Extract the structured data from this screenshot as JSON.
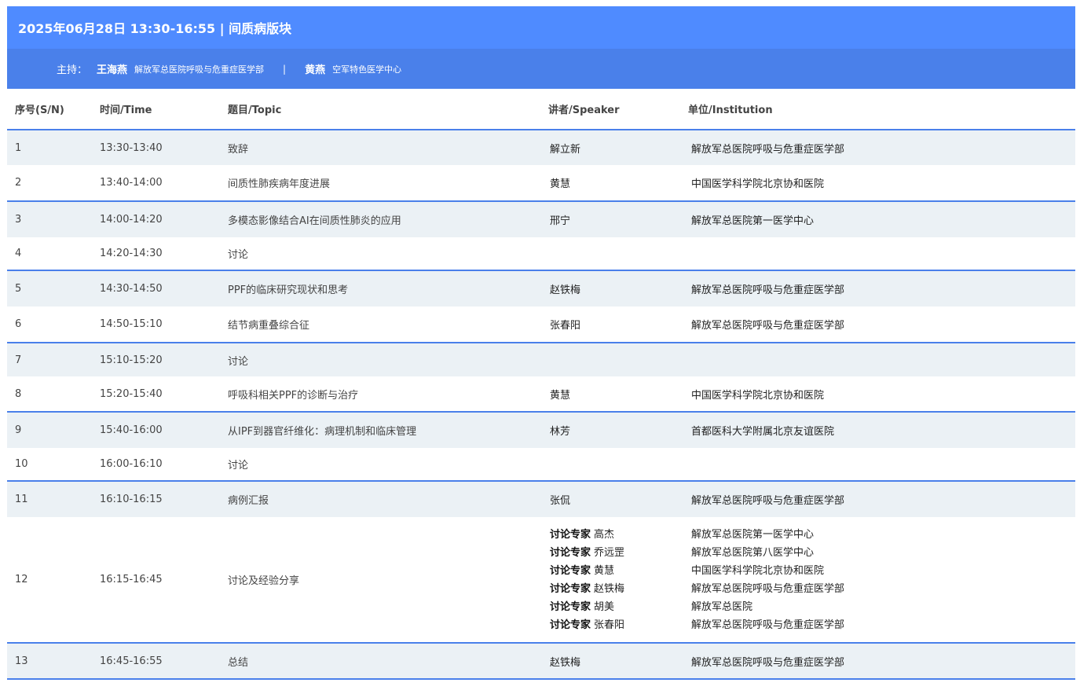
{
  "session": {
    "title": "2025年06月28日 13:30-16:55 | 间质病版块",
    "host_label": "主持：",
    "hosts": [
      {
        "name": "王海燕",
        "institution": "解放军总医院呼吸与危重症医学部"
      },
      {
        "name": "黄燕",
        "institution": "空军特色医学中心"
      }
    ],
    "host_separator": "|"
  },
  "table": {
    "headers": {
      "sn": "序号(S/N)",
      "time": "时间/Time",
      "topic": "题目/Topic",
      "speaker": "讲者/Speaker",
      "institution": "单位/Institution"
    },
    "rows": [
      {
        "sn": "1",
        "time": "13:30-13:40",
        "topic": "致辞",
        "speaker": "解立新",
        "institution": "解放军总医院呼吸与危重症医学部"
      },
      {
        "sn": "2",
        "time": "13:40-14:00",
        "topic": "间质性肺疾病年度进展",
        "speaker": "黄慧",
        "institution": "中国医学科学院北京协和医院"
      },
      {
        "sn": "3",
        "time": "14:00-14:20",
        "topic": "多模态影像结合AI在间质性肺炎的应用",
        "speaker": "邢宁",
        "institution": "解放军总医院第一医学中心"
      },
      {
        "sn": "4",
        "time": "14:20-14:30",
        "topic": "讨论",
        "speaker": "",
        "institution": ""
      },
      {
        "sn": "5",
        "time": "14:30-14:50",
        "topic": "PPF的临床研究现状和思考",
        "speaker": "赵铁梅",
        "institution": "解放军总医院呼吸与危重症医学部"
      },
      {
        "sn": "6",
        "time": "14:50-15:10",
        "topic": "结节病重叠综合征",
        "speaker": "张春阳",
        "institution": "解放军总医院呼吸与危重症医学部"
      },
      {
        "sn": "7",
        "time": "15:10-15:20",
        "topic": "讨论",
        "speaker": "",
        "institution": ""
      },
      {
        "sn": "8",
        "time": "15:20-15:40",
        "topic": "呼吸科相关PPF的诊断与治疗",
        "speaker": "黄慧",
        "institution": "中国医学科学院北京协和医院"
      },
      {
        "sn": "9",
        "time": "15:40-16:00",
        "topic": "从IPF到器官纤维化：病理机制和临床管理",
        "speaker": "林芳",
        "institution": "首都医科大学附属北京友谊医院"
      },
      {
        "sn": "10",
        "time": "16:00-16:10",
        "topic": "讨论",
        "speaker": "",
        "institution": ""
      },
      {
        "sn": "11",
        "time": "16:10-16:15",
        "topic": "病例汇报",
        "speaker": "张侃",
        "institution": "解放军总医院呼吸与危重症医学部"
      },
      {
        "sn": "12",
        "time": "16:15-16:45",
        "topic": "讨论及经验分享",
        "speaker": "",
        "institution": ""
      },
      {
        "sn": "13",
        "time": "16:45-16:55",
        "topic": "总结",
        "speaker": "赵铁梅",
        "institution": "解放军总医院呼吸与危重症医学部"
      }
    ],
    "panel": {
      "role_label": "讨论专家",
      "experts": [
        {
          "name": "高杰",
          "institution": "解放军总医院第一医学中心"
        },
        {
          "name": "乔远罡",
          "institution": "解放军总医院第八医学中心"
        },
        {
          "name": "黄慧",
          "institution": "中国医学科学院北京协和医院"
        },
        {
          "name": "赵铁梅",
          "institution": "解放军总医院呼吸与危重症医学部"
        },
        {
          "name": "胡美",
          "institution": "解放军总医院"
        },
        {
          "name": "张春阳",
          "institution": "解放军总医院呼吸与危重症医学部"
        }
      ]
    }
  },
  "colors": {
    "title_bg": "#4f8bff",
    "host_bg": "#4a80ea",
    "row_shade": "#ebf1f5",
    "divider": "#4a80ea"
  }
}
